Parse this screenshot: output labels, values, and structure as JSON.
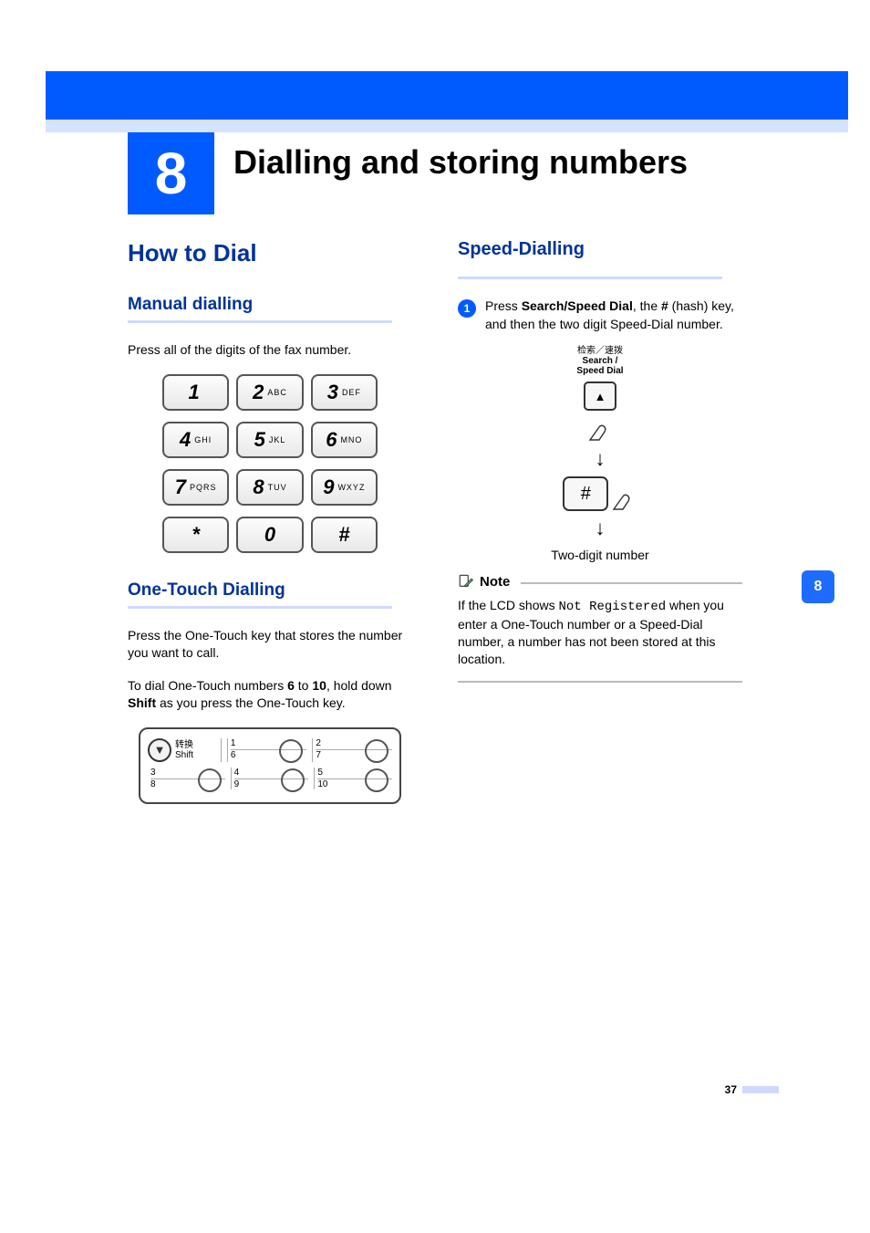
{
  "chapter": {
    "number": "8",
    "title": "Dialling and storing numbers"
  },
  "left": {
    "h2": "How to Dial",
    "manual": {
      "heading": "Manual dialling",
      "intro": "Press all of the digits of the fax number.",
      "keys": [
        [
          "1",
          ""
        ],
        [
          "2",
          "ABC"
        ],
        [
          "3",
          "DEF"
        ],
        [
          "4",
          "GHI"
        ],
        [
          "5",
          "JKL"
        ],
        [
          "6",
          "MNO"
        ],
        [
          "7",
          "PQRS"
        ],
        [
          "8",
          "TUV"
        ],
        [
          "9",
          "WXYZ"
        ],
        [
          "*",
          ""
        ],
        [
          "0",
          ""
        ],
        [
          "#",
          ""
        ]
      ]
    },
    "onetouch": {
      "heading": "One-Touch Dialling",
      "p1": "Press the One-Touch key that stores the number you want to call.",
      "p2a": "To dial One-Touch numbers ",
      "p2b_strong1": "6",
      "p2c": " to ",
      "p2d_strong2": "10",
      "p2e": ", hold down ",
      "p2f_strong3": "Shift",
      "p2g": " as you press the One-Touch key.",
      "shift_cjk": "转换",
      "shift_en": "Shift",
      "cells": [
        {
          "top": "1",
          "bot": "6"
        },
        {
          "top": "2",
          "bot": "7"
        },
        {
          "top": "3",
          "bot": "8"
        },
        {
          "top": "4",
          "bot": "9"
        },
        {
          "top": "5",
          "bot": "10"
        }
      ]
    }
  },
  "right": {
    "heading": "Speed-Dialling",
    "step1_num": "1",
    "step1_a": "Press ",
    "step1_b_strong": "Search/Speed Dial",
    "step1_c": ", the ",
    "step1_d_strong": "#",
    "step1_e": " (hash) key, and then the two digit Speed-Dial number.",
    "sd_label_cjk": "检索／速拨",
    "sd_label_en1": "Search /",
    "sd_label_en2": "Speed Dial",
    "hash": "#",
    "twodigit": "Two-digit number",
    "note": {
      "title": "Note",
      "a": "If the LCD shows ",
      "mono": "Not Registered",
      "b": " when you enter a One-Touch number or a Speed-Dial number, a number has not been stored at this location."
    }
  },
  "side_tab": "8",
  "page_number": "37"
}
